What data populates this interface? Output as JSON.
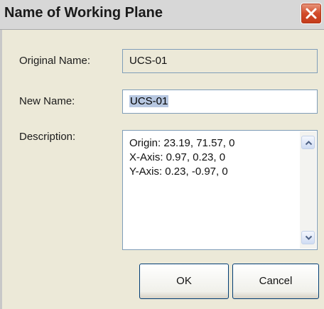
{
  "window": {
    "title": "Name of Working Plane",
    "close_icon": "close-icon"
  },
  "form": {
    "original_name_label": "Original Name:",
    "original_name_value": "UCS-01",
    "new_name_label": "New Name:",
    "new_name_value": "UCS-01",
    "description_label": "Description:",
    "description_lines": [
      "Origin: 23.19, 71.57, 0",
      "X-Axis: 0.97, 0.23, 0",
      "Y-Axis: 0.23, -0.97, 0"
    ]
  },
  "buttons": {
    "ok_label": "OK",
    "cancel_label": "Cancel"
  },
  "colors": {
    "close_button": "#d24b2b",
    "selection_highlight": "#b7c7e1",
    "field_border": "#7f9db9"
  }
}
